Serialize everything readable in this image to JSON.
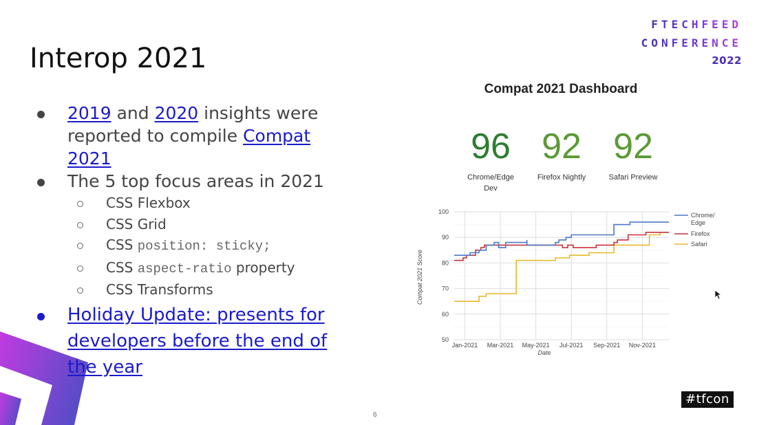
{
  "slide": {
    "title": "Interop 2021",
    "page_number": "6",
    "hashtag": "#tfcon",
    "logo": {
      "line1": "FTECHFEED",
      "line2": "CONFERENCE",
      "line3": "2022",
      "colors": [
        "#3b2fae",
        "#b43ee0"
      ]
    },
    "link_color": "#1a1acd"
  },
  "bullets": {
    "b1": {
      "link1": "2019",
      "t1": " and ",
      "link2": "2020",
      "t2": " insights were reported to compile ",
      "link3": "Compat 2021"
    },
    "b2": {
      "text": "The 5 top focus areas in 2021"
    },
    "focus_areas": [
      {
        "prefix": "CSS Flexbox",
        "code": "",
        "suffix": ""
      },
      {
        "prefix": "CSS Grid",
        "code": "",
        "suffix": ""
      },
      {
        "prefix": "CSS ",
        "code": "position: sticky;",
        "suffix": ""
      },
      {
        "prefix": "CSS ",
        "code": "aspect-ratio",
        "suffix": " property"
      },
      {
        "prefix": "CSS Transforms",
        "code": "",
        "suffix": ""
      }
    ],
    "b3": {
      "link": "Holiday Update: presents for developers before the end of the year"
    }
  },
  "dashboard": {
    "title": "Compat 2021 Dashboard",
    "scores": [
      {
        "value": "96",
        "label_line1": "Chrome/Edge",
        "label_line2": "Dev",
        "color": "#2e7d32"
      },
      {
        "value": "92",
        "label_line1": "Firefox Nightly",
        "label_line2": "",
        "color": "#5b9a35"
      },
      {
        "value": "92",
        "label_line1": "Safari Preview",
        "label_line2": "",
        "color": "#5b9a35"
      }
    ]
  },
  "chart_data": {
    "type": "line",
    "title": "",
    "xlabel": "Date",
    "ylabel": "Compat 2021 Score",
    "ylim": [
      50,
      100
    ],
    "xlim_months": [
      -0.6,
      11.5
    ],
    "x_unit": "months since Jan-2021",
    "yticks": [
      50,
      60,
      70,
      80,
      90,
      100
    ],
    "xticks": [
      {
        "label": "Jan-2021",
        "m": 0
      },
      {
        "label": "Mar-2021",
        "m": 2
      },
      {
        "label": "May-2021",
        "m": 4
      },
      {
        "label": "Jul-2021",
        "m": 6
      },
      {
        "label": "Sep-2021",
        "m": 8
      },
      {
        "label": "Nov-2021",
        "m": 10
      }
    ],
    "grid": true,
    "legend_position": "right",
    "step": true,
    "series": [
      {
        "name": "Chrome/Edge",
        "legend_line1": "Chrome/",
        "legend_line2": "Edge",
        "color": "#4a78c8",
        "points": [
          [
            -0.6,
            83
          ],
          [
            0.3,
            83
          ],
          [
            0.3,
            84
          ],
          [
            0.8,
            84
          ],
          [
            0.8,
            85
          ],
          [
            1.2,
            85
          ],
          [
            1.2,
            87
          ],
          [
            1.65,
            87
          ],
          [
            1.65,
            88
          ],
          [
            1.9,
            88
          ],
          [
            1.9,
            86
          ],
          [
            2.3,
            86
          ],
          [
            2.3,
            88
          ],
          [
            3.5,
            88
          ],
          [
            3.5,
            89
          ],
          [
            3.5,
            87
          ],
          [
            5.1,
            87
          ],
          [
            5.1,
            88
          ],
          [
            5.3,
            88
          ],
          [
            5.3,
            89
          ],
          [
            5.7,
            89
          ],
          [
            5.7,
            90
          ],
          [
            6.0,
            90
          ],
          [
            6.0,
            91
          ],
          [
            8.4,
            91
          ],
          [
            8.4,
            95
          ],
          [
            9.3,
            95
          ],
          [
            9.3,
            96
          ],
          [
            11.5,
            96
          ]
        ]
      },
      {
        "name": "Firefox",
        "legend_line1": "Firefox",
        "legend_line2": "",
        "color": "#c8323c",
        "points": [
          [
            -0.6,
            81
          ],
          [
            -0.1,
            81
          ],
          [
            -0.1,
            82
          ],
          [
            0.1,
            82
          ],
          [
            0.1,
            83
          ],
          [
            0.6,
            83
          ],
          [
            0.6,
            85
          ],
          [
            0.9,
            85
          ],
          [
            0.9,
            86
          ],
          [
            1.1,
            86
          ],
          [
            1.1,
            87
          ],
          [
            5.5,
            87
          ],
          [
            5.5,
            86
          ],
          [
            5.8,
            86
          ],
          [
            5.8,
            87
          ],
          [
            6.1,
            87
          ],
          [
            6.1,
            86
          ],
          [
            7.4,
            86
          ],
          [
            7.4,
            87
          ],
          [
            8.4,
            87
          ],
          [
            8.4,
            88
          ],
          [
            8.6,
            88
          ],
          [
            8.6,
            89
          ],
          [
            9.2,
            89
          ],
          [
            9.2,
            91
          ],
          [
            10.2,
            91
          ],
          [
            10.2,
            92
          ],
          [
            11.5,
            92
          ]
        ]
      },
      {
        "name": "Safari",
        "legend_line1": "Safari",
        "legend_line2": "",
        "color": "#e8b92a",
        "points": [
          [
            -0.6,
            65
          ],
          [
            0.8,
            65
          ],
          [
            0.8,
            67
          ],
          [
            1.2,
            67
          ],
          [
            1.2,
            68
          ],
          [
            2.9,
            68
          ],
          [
            2.9,
            81
          ],
          [
            5.1,
            81
          ],
          [
            5.1,
            82
          ],
          [
            5.9,
            82
          ],
          [
            5.9,
            83
          ],
          [
            7.0,
            83
          ],
          [
            7.0,
            84
          ],
          [
            8.4,
            84
          ],
          [
            8.4,
            87
          ],
          [
            10.4,
            87
          ],
          [
            10.4,
            91
          ],
          [
            11.0,
            91
          ],
          [
            11.0,
            92
          ],
          [
            11.5,
            92
          ]
        ]
      }
    ]
  }
}
